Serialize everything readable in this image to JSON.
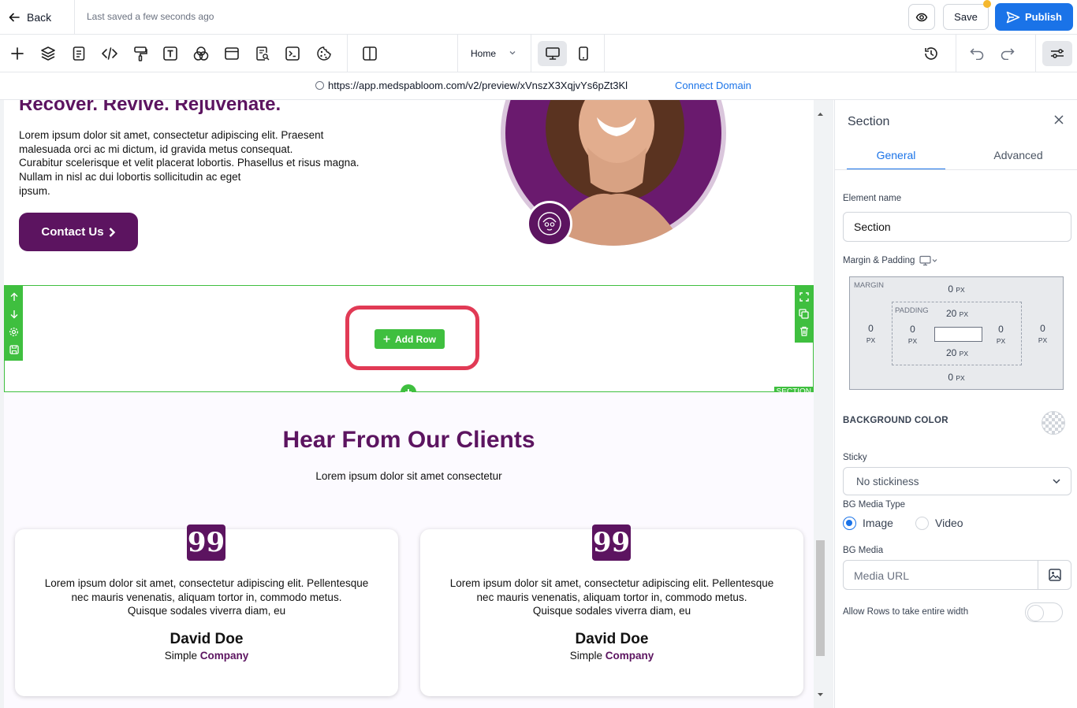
{
  "header": {
    "back_label": "Back",
    "last_saved": "Last saved a few seconds ago",
    "save_label": "Save",
    "publish_label": "Publish"
  },
  "toolbar": {
    "tools": [
      "plus-icon",
      "layers-icon",
      "page-icon",
      "code-icon",
      "paint-roller-icon",
      "text-icon",
      "color-circles-icon",
      "layout-icon",
      "search-page-icon",
      "terminal-icon",
      "cookie-icon",
      "columns-icon"
    ],
    "page_select": "Home",
    "device_active": "desktop"
  },
  "urlbar": {
    "url": "https://app.medspabloom.com/v2/preview/xVnszX3XqjvYs6pZt3Kl",
    "connect_label": "Connect Domain"
  },
  "canvas": {
    "hero": {
      "heading": "Recover. Revive. Rejuvenate.",
      "paragraph_lines": [
        "Lorem ipsum dolor sit amet, consectetur adipiscing elit. Praesent",
        "malesuada orci ac mi dictum, id gravida metus consequat.",
        "Curabitur scelerisque et velit placerat lobortis. Phasellus et risus magna.",
        "Nullam in nisl ac dui lobortis sollicitudin ac eget",
        "ipsum."
      ],
      "cta_label": "Contact Us"
    },
    "selected_section": {
      "add_row_label": "Add Row",
      "tag": "SECTION"
    },
    "testimonials": {
      "title": "Hear From Our Clients",
      "subtitle": "Lorem ipsum dolor sit amet consectetur",
      "cards": [
        {
          "quote_mark": "99",
          "text_lines": [
            "Lorem ipsum dolor sit amet, consectetur adipiscing elit. Pellentesque",
            "nec mauris venenatis, aliquam tortor in, commodo metus.",
            "Quisque sodales viverra diam, eu"
          ],
          "name": "David Doe",
          "company_prefix": "Simple",
          "company_accent": "Company"
        },
        {
          "quote_mark": "99",
          "text_lines": [
            "Lorem ipsum dolor sit amet, consectetur adipiscing elit. Pellentesque",
            "nec mauris venenatis, aliquam tortor in, commodo metus.",
            "Quisque sodales viverra diam, eu"
          ],
          "name": "David Doe",
          "company_prefix": "Simple",
          "company_accent": "Company"
        }
      ]
    }
  },
  "panel": {
    "title": "Section",
    "tabs": [
      "General",
      "Advanced"
    ],
    "active_tab": "General",
    "element_name_label": "Element name",
    "element_name_value": "Section",
    "margin_padding_label": "Margin & Padding",
    "margin_label": "MARGIN",
    "padding_label": "PADDING",
    "unit": "PX",
    "margin": {
      "top": "0",
      "right": "0",
      "bottom": "0",
      "left": "0"
    },
    "padding": {
      "top": "20",
      "right": "0",
      "bottom": "20",
      "left": "0"
    },
    "bg_color_label": "BACKGROUND COLOR",
    "sticky_label": "Sticky",
    "sticky_value": "No stickiness",
    "bg_media_type_label": "BG Media Type",
    "bg_media_type_options": [
      "Image",
      "Video"
    ],
    "bg_media_type_selected": "Image",
    "bg_media_label": "BG Media",
    "bg_media_placeholder": "Media URL",
    "full_width_label": "Allow Rows to take entire width",
    "full_width_enabled": false
  },
  "colors": {
    "brand_purple": "#5c1460",
    "primary_blue": "#1a73e8",
    "builder_green": "#3fbf3f",
    "highlight_red": "#e13a55"
  }
}
